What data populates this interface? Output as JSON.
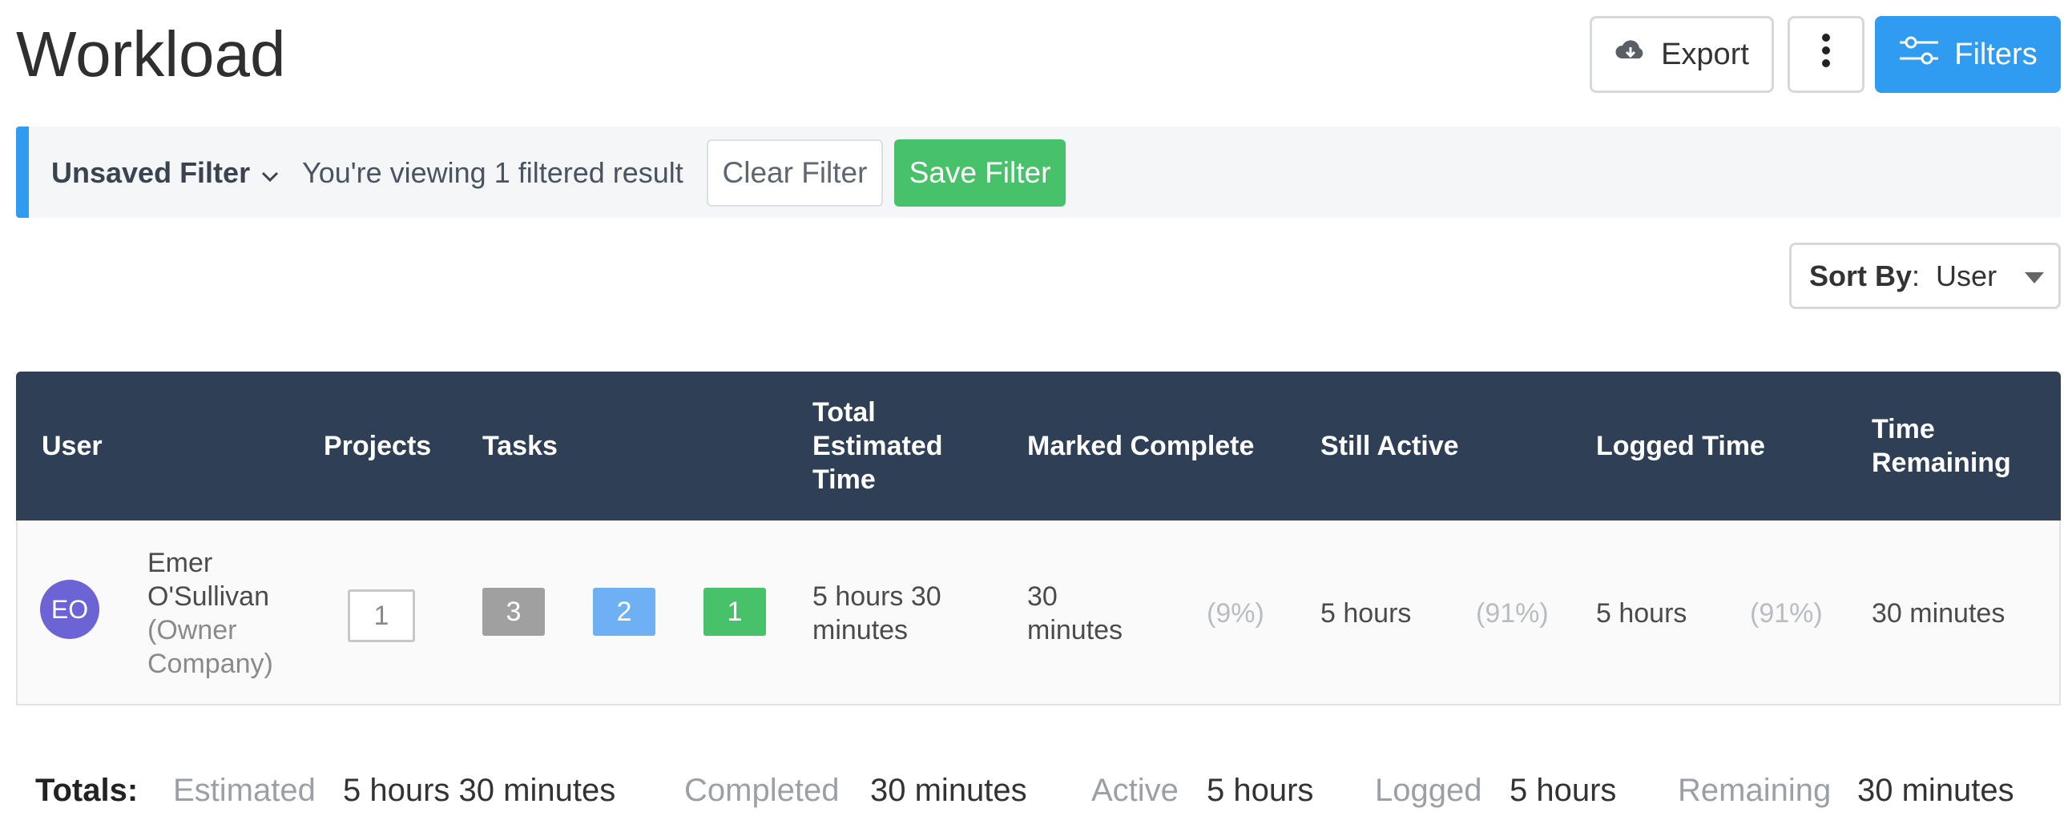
{
  "header": {
    "title": "Workload",
    "export_label": "Export",
    "filters_label": "Filters"
  },
  "filter_bar": {
    "name": "Unsaved Filter",
    "info": "You're viewing 1 filtered result",
    "clear_label": "Clear Filter",
    "save_label": "Save Filter"
  },
  "sort": {
    "label": "Sort By",
    "value": "User"
  },
  "table": {
    "columns": {
      "user": "User",
      "projects": "Projects",
      "tasks": "Tasks",
      "total_line1": "Total",
      "total_line2": "Estimated",
      "total_line3": "Time",
      "marked_complete": "Marked Complete",
      "still_active": "Still Active",
      "logged_time": "Logged Time",
      "remaining_line1": "Time",
      "remaining_line2": "Remaining"
    },
    "rows": [
      {
        "initials": "EO",
        "name_line1": "Emer",
        "name_line2": "O'Sullivan",
        "company_line1": "(Owner",
        "company_line2": "Company)",
        "projects": "1",
        "tasks_total": "3",
        "tasks_active": "2",
        "tasks_complete": "1",
        "estimated_line1": "5 hours 30",
        "estimated_line2": "minutes",
        "complete_line1": "30",
        "complete_line2": "minutes",
        "complete_pct": "(9%)",
        "active": "5 hours",
        "active_pct": "(91%)",
        "logged": "5 hours",
        "logged_pct": "(91%)",
        "remaining": "30 minutes"
      }
    ]
  },
  "totals": {
    "title": "Totals:",
    "estimated_label": "Estimated",
    "estimated_value": "5 hours 30 minutes",
    "completed_label": "Completed",
    "completed_value": "30 minutes",
    "active_label": "Active",
    "active_value": "5 hours",
    "logged_label": "Logged",
    "logged_value": "5 hours",
    "remaining_label": "Remaining",
    "remaining_value": "30 minutes"
  },
  "colors": {
    "accent": "#2f9cf2",
    "success": "#47c26b",
    "table_header": "#2e3f56",
    "avatar": "#6c63d4"
  },
  "icons": [
    "cloud-download-icon",
    "more-vertical-icon",
    "sliders-icon",
    "chevron-down-icon",
    "caret-down-icon"
  ]
}
